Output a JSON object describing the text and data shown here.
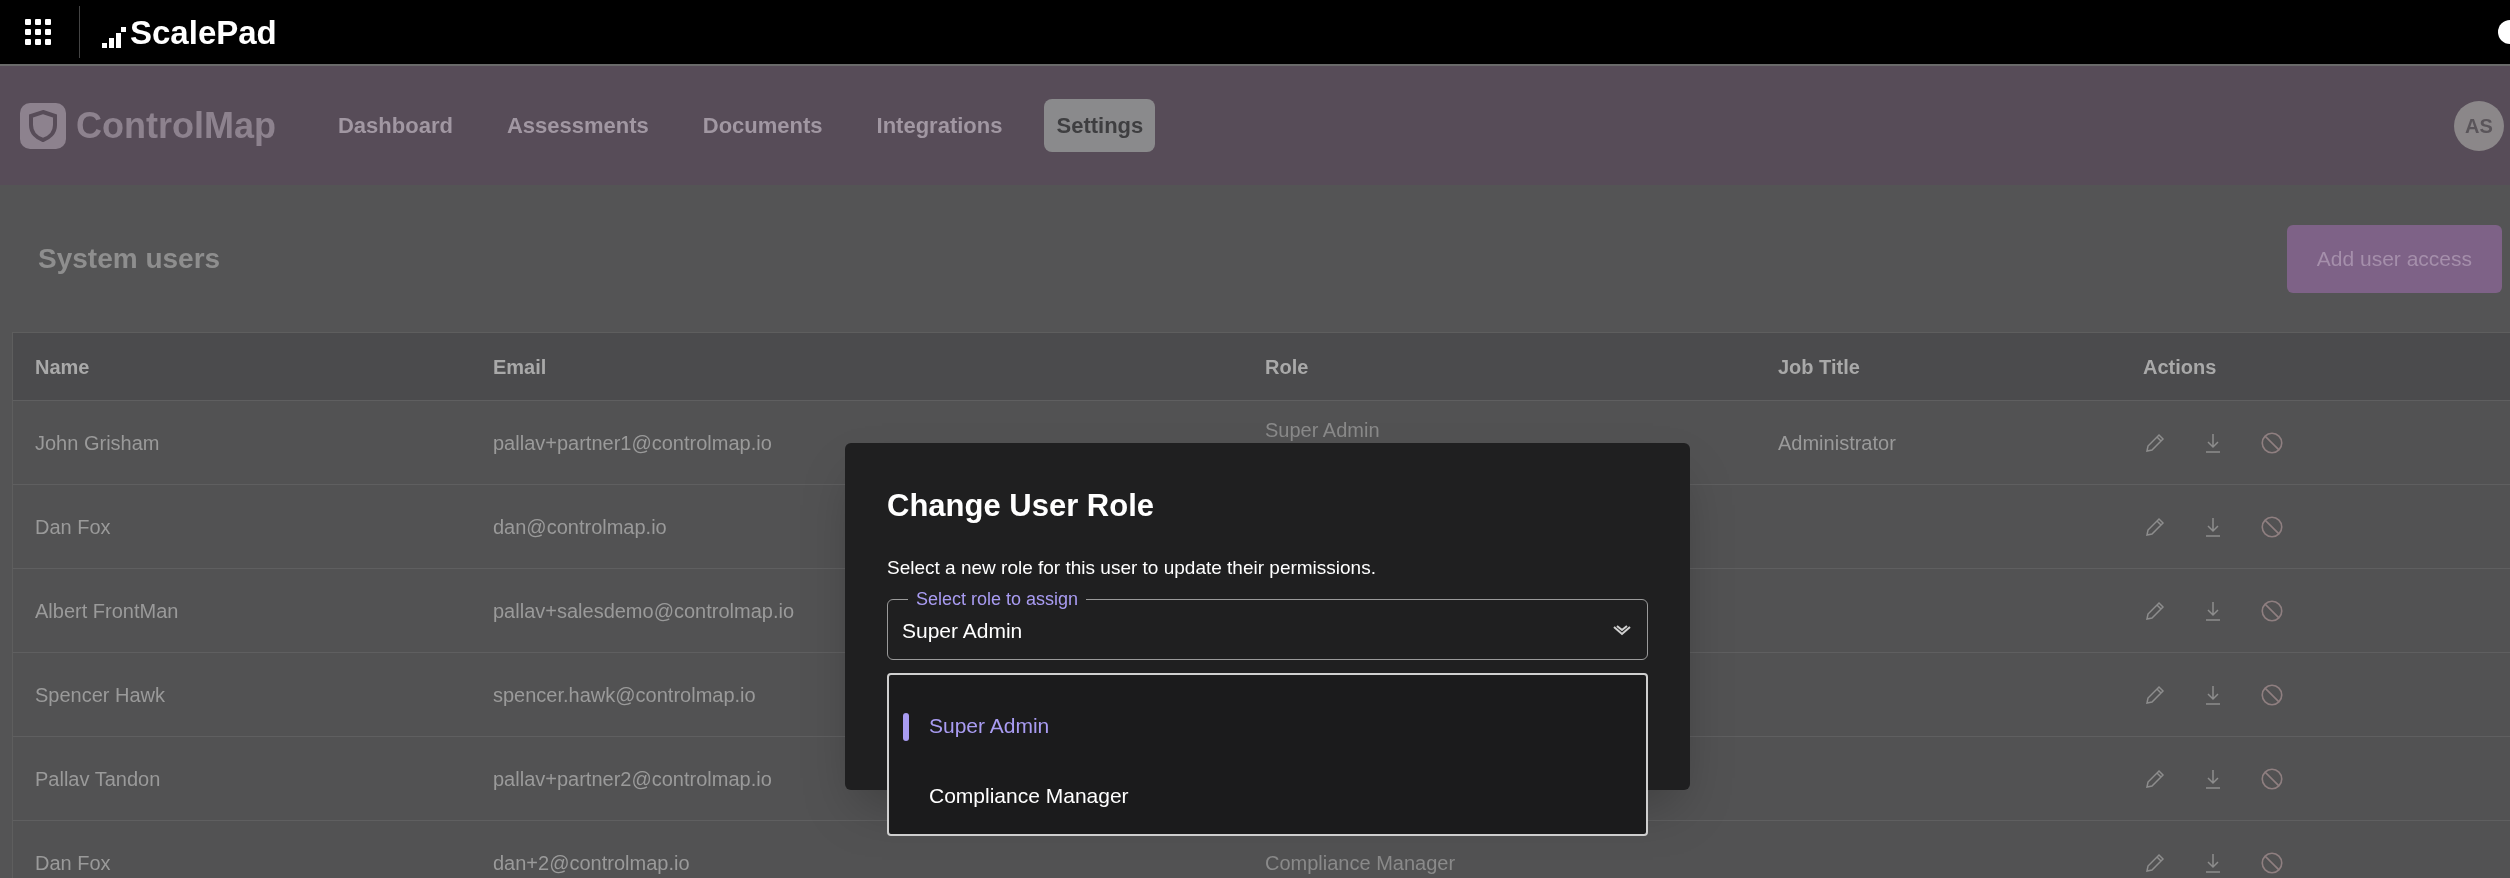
{
  "top_bar": {
    "brand": "ScalePad"
  },
  "nav": {
    "brand": "ControlMap",
    "avatar": "AS",
    "items": [
      {
        "label": "Dashboard",
        "selected": false
      },
      {
        "label": "Assessments",
        "selected": false
      },
      {
        "label": "Documents",
        "selected": false
      },
      {
        "label": "Integrations",
        "selected": false
      },
      {
        "label": "Settings",
        "selected": true
      }
    ]
  },
  "page": {
    "title": "System users",
    "add_button": "Add user access"
  },
  "table": {
    "columns": [
      "Name",
      "Email",
      "Role",
      "Job Title",
      "Actions"
    ],
    "rows": [
      {
        "name": "John Grisham",
        "email": "pallav+partner1@controlmap.io",
        "role": "Super Admin",
        "job_title": "Administrator"
      },
      {
        "name": "Dan Fox",
        "email": "dan@controlmap.io"
      },
      {
        "name": "Albert FrontMan",
        "email": "pallav+salesdemo@controlmap.io"
      },
      {
        "name": "Spencer Hawk",
        "email": "spencer.hawk@controlmap.io"
      },
      {
        "name": "Pallav Tandon",
        "email": "pallav+partner2@controlmap.io"
      },
      {
        "name": "Dan Fox",
        "email": "dan+2@controlmap.io",
        "role": "Compliance Manager"
      }
    ]
  },
  "modal": {
    "title": "Change User Role",
    "description": "Select a new role for this user to update their permissions.",
    "select": {
      "label": "Select role to assign",
      "value": "Super Admin",
      "expanded": true
    },
    "options": [
      {
        "label": "Super Admin",
        "selected": true
      },
      {
        "label": "Compliance Manager",
        "selected": false
      }
    ]
  }
}
